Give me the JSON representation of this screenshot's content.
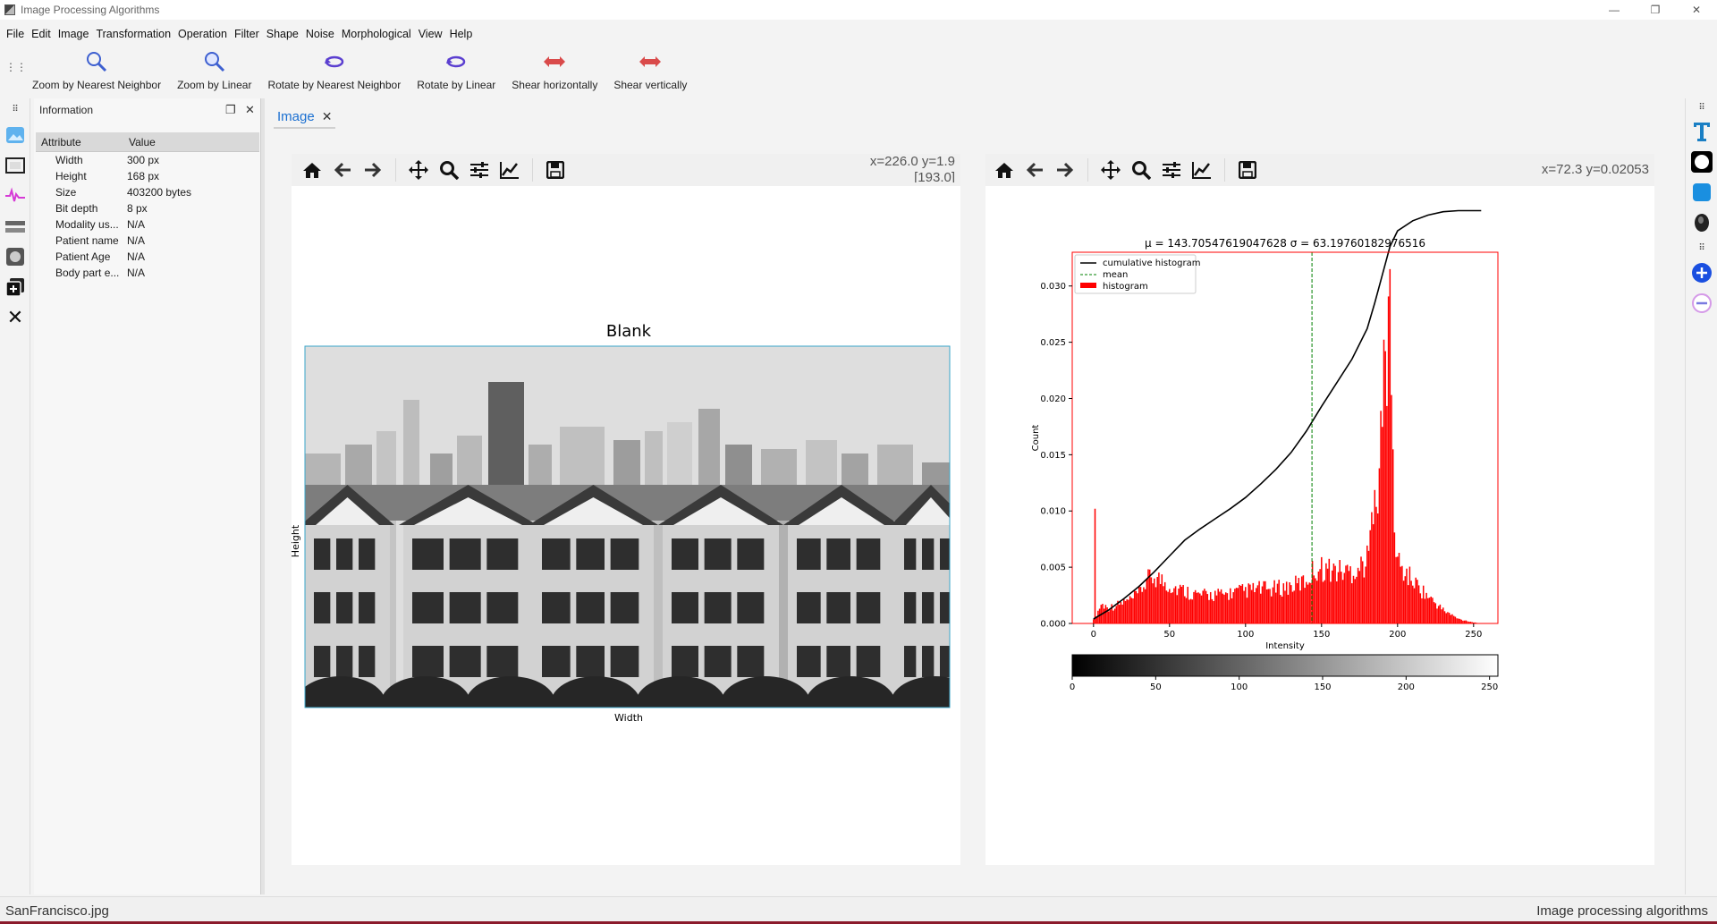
{
  "window": {
    "title": "Image Processing Algorithms"
  },
  "menu": [
    "File",
    "Edit",
    "Image",
    "Transformation",
    "Operation",
    "Filter",
    "Shape",
    "Noise",
    "Morphological",
    "View",
    "Help"
  ],
  "toolbar": [
    {
      "label": "Zoom by Nearest Neighbor",
      "icon": "zoom-nearest-icon"
    },
    {
      "label": "Zoom by Linear",
      "icon": "zoom-linear-icon"
    },
    {
      "label": "Rotate by Nearest Neighbor",
      "icon": "rotate-nearest-icon"
    },
    {
      "label": "Rotate by Linear",
      "icon": "rotate-linear-icon"
    },
    {
      "label": "Shear horizontally",
      "icon": "shear-horizontal-icon"
    },
    {
      "label": "Shear vertically",
      "icon": "shear-vertical-icon"
    }
  ],
  "info": {
    "title": "Information",
    "headers": [
      "Attribute",
      "Value"
    ],
    "rows": [
      [
        "Width",
        "300 px"
      ],
      [
        "Height",
        "168 px"
      ],
      [
        "Size",
        "403200 bytes"
      ],
      [
        "Bit depth",
        "8 px"
      ],
      [
        "Modality us...",
        "N/A"
      ],
      [
        "Patient name",
        "N/A"
      ],
      [
        "Patient Age",
        "N/A"
      ],
      [
        "Body part e...",
        "N/A"
      ]
    ]
  },
  "tab": {
    "label": "Image",
    "close": "✕"
  },
  "left_plot": {
    "coord_line1": "x=226.0 y=1.9",
    "coord_line2": "[193.0]",
    "title": "Blank",
    "xlabel": "Width",
    "ylabel": "Height"
  },
  "right_plot": {
    "coord": "x=72.3 y=0.02053"
  },
  "chart_data": {
    "type": "bar",
    "title": "μ = 143.70547619047628    σ = 63.19760182976516",
    "xlabel": "Intensity",
    "ylabel": "Count",
    "xlim": [
      -14,
      266
    ],
    "ylim": [
      0,
      0.033
    ],
    "xticks": [
      0,
      50,
      100,
      150,
      200,
      250
    ],
    "yticks": [
      "0.000",
      "0.005",
      "0.010",
      "0.015",
      "0.020",
      "0.025",
      "0.030"
    ],
    "mean": 143.7,
    "legend": {
      "placement": "top-left",
      "entries": [
        "cumulative histogram",
        "mean",
        "histogram"
      ]
    },
    "colors": {
      "histogram": "#ff0000",
      "cumulative": "#000000",
      "mean": "#008000",
      "frame": "#ff0000"
    },
    "histogram_anchors": [
      [
        0,
        0.0005
      ],
      [
        1,
        0.0102
      ],
      [
        2,
        0.0008
      ],
      [
        5,
        0.0017
      ],
      [
        10,
        0.0014
      ],
      [
        15,
        0.0016
      ],
      [
        20,
        0.0019
      ],
      [
        25,
        0.0021
      ],
      [
        30,
        0.0027
      ],
      [
        35,
        0.0038
      ],
      [
        40,
        0.0042
      ],
      [
        45,
        0.0038
      ],
      [
        50,
        0.0034
      ],
      [
        55,
        0.0031
      ],
      [
        60,
        0.0029
      ],
      [
        65,
        0.0027
      ],
      [
        70,
        0.0025
      ],
      [
        75,
        0.0025
      ],
      [
        80,
        0.0026
      ],
      [
        85,
        0.0025
      ],
      [
        90,
        0.0027
      ],
      [
        95,
        0.0028
      ],
      [
        100,
        0.0029
      ],
      [
        105,
        0.003
      ],
      [
        110,
        0.0031
      ],
      [
        115,
        0.003
      ],
      [
        120,
        0.0031
      ],
      [
        125,
        0.0032
      ],
      [
        130,
        0.0033
      ],
      [
        135,
        0.0035
      ],
      [
        140,
        0.0038
      ],
      [
        145,
        0.0048
      ],
      [
        150,
        0.0049
      ],
      [
        155,
        0.0048
      ],
      [
        160,
        0.0047
      ],
      [
        165,
        0.0046
      ],
      [
        170,
        0.0047
      ],
      [
        175,
        0.005
      ],
      [
        180,
        0.0056
      ],
      [
        183,
        0.0085
      ],
      [
        185,
        0.015
      ],
      [
        187,
        0.011
      ],
      [
        190,
        0.0185
      ],
      [
        192,
        0.025
      ],
      [
        194,
        0.0235
      ],
      [
        195,
        0.0315
      ],
      [
        197,
        0.0135
      ],
      [
        199,
        0.006
      ],
      [
        203,
        0.0048
      ],
      [
        210,
        0.0038
      ],
      [
        220,
        0.0024
      ],
      [
        230,
        0.0012
      ],
      [
        240,
        0.0004
      ],
      [
        250,
        0.0001
      ],
      [
        255,
        0.0
      ]
    ],
    "cumulative_anchors": [
      [
        0,
        0.0004
      ],
      [
        10,
        0.0012
      ],
      [
        20,
        0.0022
      ],
      [
        30,
        0.0033
      ],
      [
        40,
        0.0046
      ],
      [
        50,
        0.006
      ],
      [
        60,
        0.0074
      ],
      [
        70,
        0.0084
      ],
      [
        80,
        0.0093
      ],
      [
        90,
        0.0102
      ],
      [
        100,
        0.0112
      ],
      [
        110,
        0.0124
      ],
      [
        120,
        0.0137
      ],
      [
        130,
        0.0152
      ],
      [
        140,
        0.0171
      ],
      [
        150,
        0.0193
      ],
      [
        160,
        0.0214
      ],
      [
        170,
        0.0235
      ],
      [
        180,
        0.0262
      ],
      [
        185,
        0.0285
      ],
      [
        190,
        0.031
      ],
      [
        195,
        0.0335
      ],
      [
        200,
        0.0349
      ],
      [
        210,
        0.0358
      ],
      [
        220,
        0.0363
      ],
      [
        230,
        0.0366
      ],
      [
        240,
        0.0367
      ],
      [
        255,
        0.0367
      ]
    ]
  },
  "colorbar": {
    "ticks": [
      0,
      50,
      100,
      150,
      200,
      250
    ]
  },
  "status": {
    "left": "SanFrancisco.jpg",
    "right": "Image processing algorithms"
  }
}
